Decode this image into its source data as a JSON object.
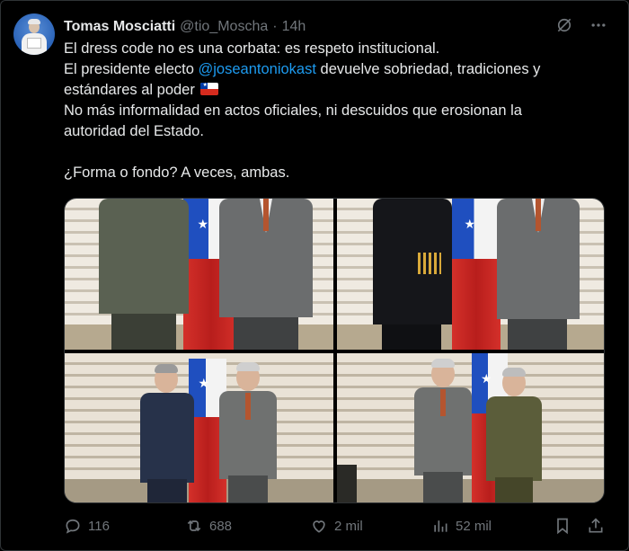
{
  "author": {
    "name": "Tomas Mosciatti",
    "handle": "@tio_Moscha",
    "separator": "·",
    "time": "14h"
  },
  "post": {
    "line1": "El dress code no es una corbata: es respeto institucional.",
    "line2_before": "El presidente electo ",
    "line2_mention": "@joseantoniokast",
    "line2_after": " devuelve sobriedad, tradiciones y",
    "line3": "estándares al poder ",
    "line4": "No más informalidad en actos oficiales, ni descuidos que erosionan la",
    "line5": "autoridad del Estado.",
    "line6": "¿Forma o fondo? A veces, ambas."
  },
  "header_icons": [
    "grok-icon",
    "more-icon"
  ],
  "actions": {
    "replies": "116",
    "reposts": "688",
    "likes": "2 mil",
    "views": "52 mil"
  },
  "colors": {
    "background": "#000000",
    "text": "#e7e9ea",
    "muted": "#71767b",
    "accent": "#1d9bf0"
  }
}
